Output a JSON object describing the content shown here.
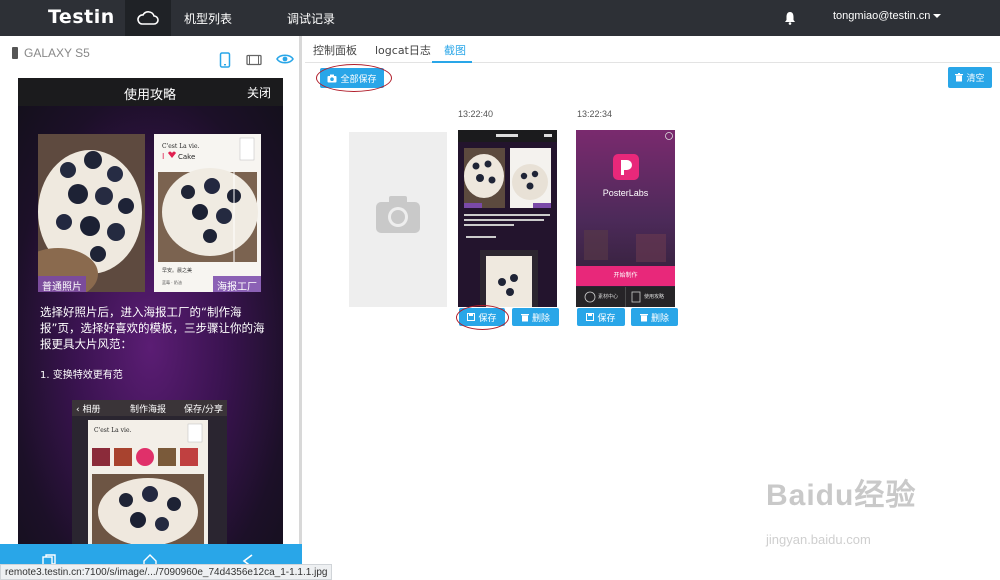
{
  "header": {
    "logo": "Testin",
    "nav": [
      "机型列表",
      "调试记录"
    ],
    "user": "tongmiao@testin.cn"
  },
  "device": {
    "name": "GALAXY S5",
    "screen": {
      "title": "使用攻略",
      "close": "关闭",
      "tag_left": "普通照片",
      "tag_right": "海报工厂",
      "description": "选择好照片后，进入海报工厂的“制作海报”页，选择好喜欢的模板，三步骤让你的海报更具大片风范：",
      "step": "1.  变换特效更有范",
      "inner_back": "相册",
      "inner_title": "制作海报",
      "inner_right": "保存/分享"
    }
  },
  "tabs": [
    "控制面板",
    "logcat日志",
    "截图"
  ],
  "toolbar": {
    "save_all": "全部保存",
    "clear": "清空"
  },
  "screenshots": [
    {
      "time": "13:22:40",
      "save": "保存",
      "delete": "删除",
      "app_name": "",
      "cta": "",
      "menu_left": "",
      "menu_right": ""
    },
    {
      "time": "13:22:34",
      "save": "保存",
      "delete": "删除",
      "app_name": "PosterLabs",
      "cta": "开始制作",
      "menu_left": "素材中心",
      "menu_right": "使用攻略"
    }
  ],
  "status_url": "remote3.testin.cn:7100/s/image/.../7090960e_74d4356e12ca_1-1.1.1.jpg",
  "watermark": {
    "brand": "Baidu经验",
    "url": "jingyan.baidu.com"
  },
  "colors": {
    "accent": "#29a6e8",
    "topbar": "#2d3036",
    "annotation": "#b01e2b"
  }
}
